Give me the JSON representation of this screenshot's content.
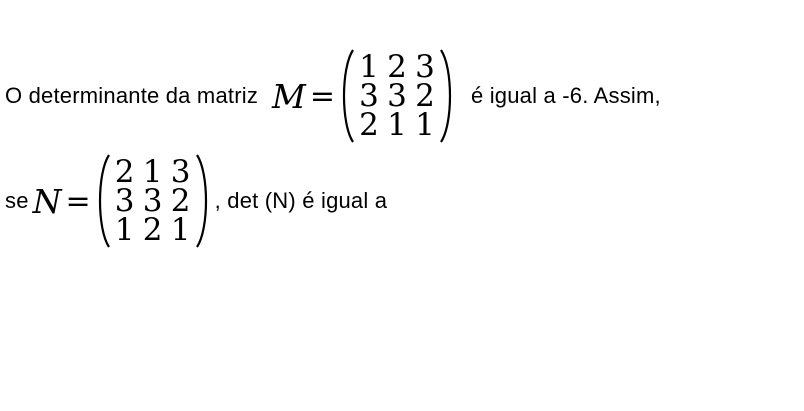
{
  "line1": {
    "prefix": "O determinante da matriz",
    "var": "M",
    "equals": "=",
    "suffix": "é igual a -6. Assim,"
  },
  "matrix_m": {
    "rows": [
      [
        "1",
        "2",
        "3"
      ],
      [
        "3",
        "3",
        "2"
      ],
      [
        "2",
        "1",
        "1"
      ]
    ]
  },
  "line2": {
    "prefix": "se",
    "var": "N",
    "equals": "=",
    "suffix": ", det (N) é igual a"
  },
  "matrix_n": {
    "rows": [
      [
        "2",
        "1",
        "3"
      ],
      [
        "3",
        "3",
        "2"
      ],
      [
        "1",
        "2",
        "1"
      ]
    ]
  }
}
